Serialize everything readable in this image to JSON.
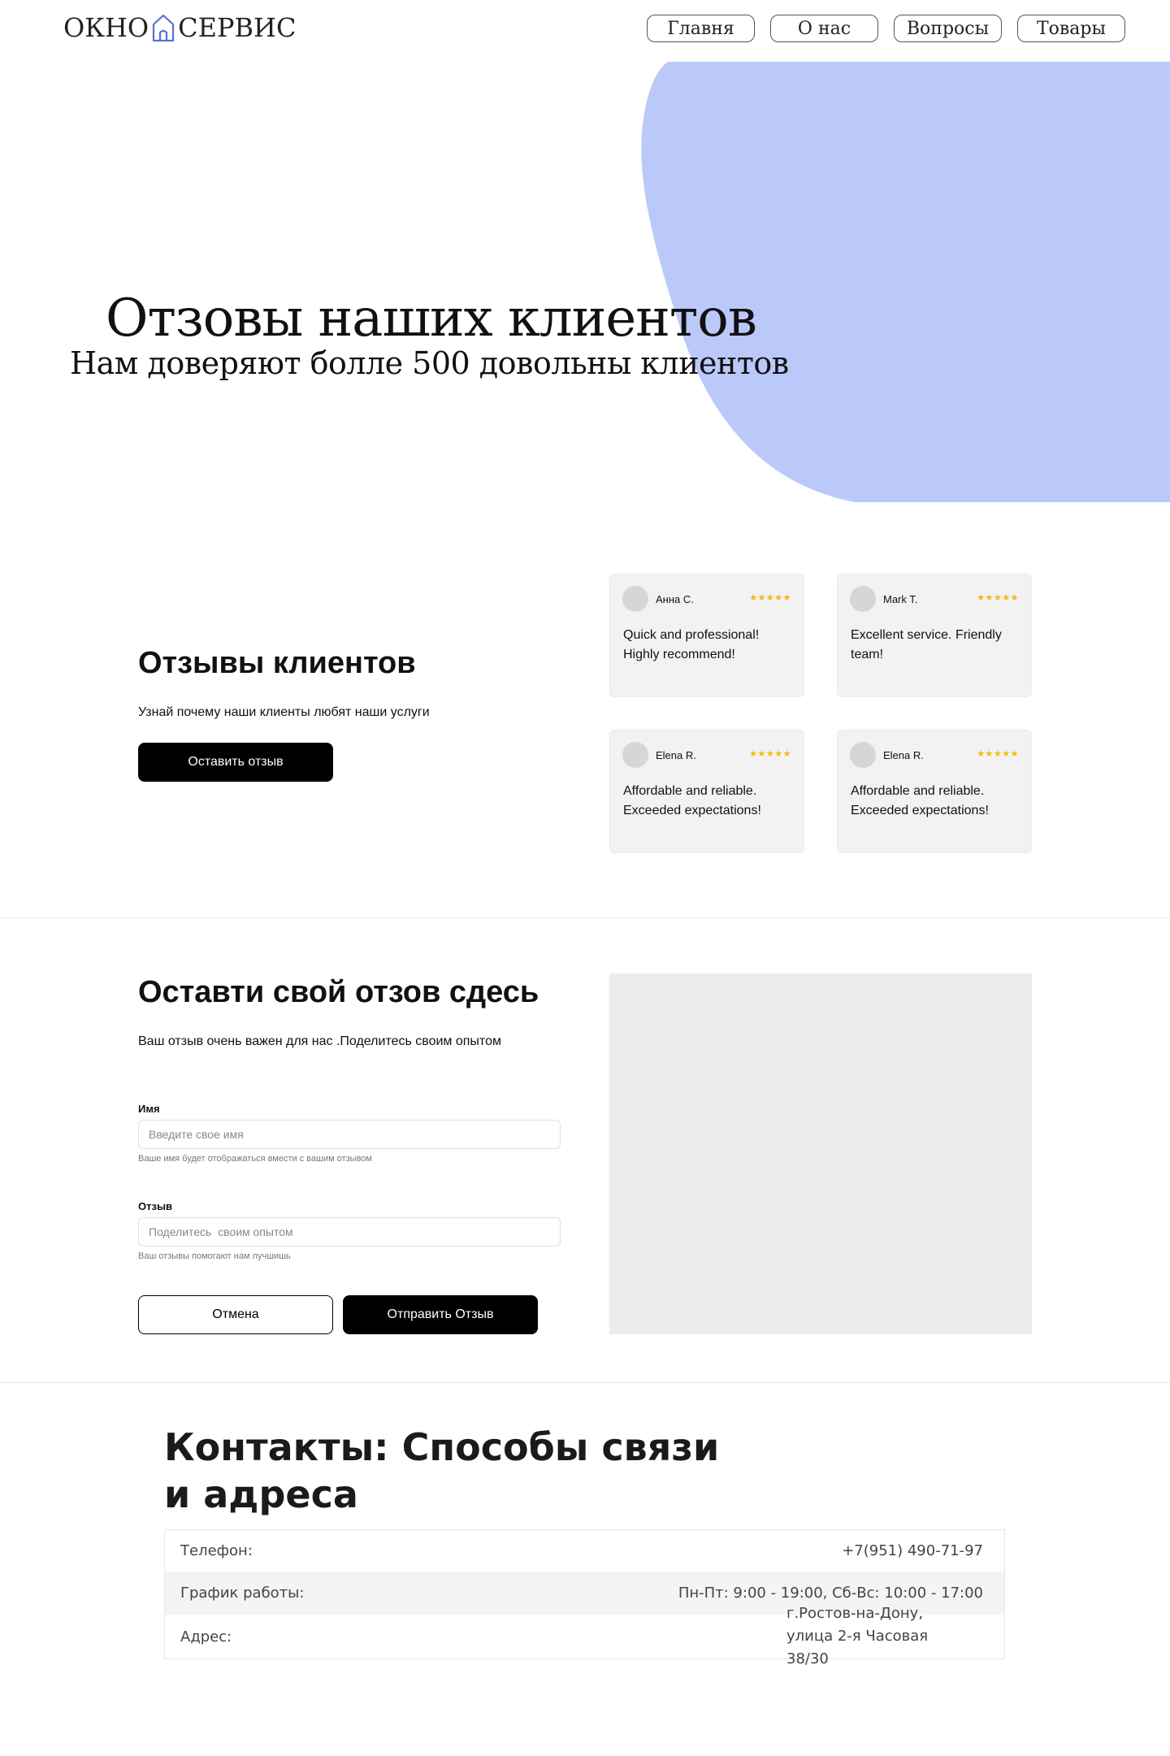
{
  "header": {
    "logo_left": "ОКНО",
    "logo_icon": "house-icon",
    "logo_right": "СЕРВИС",
    "nav": [
      "Главня",
      "О нас",
      "Вопросы",
      "Товары"
    ]
  },
  "hero": {
    "title": "Отзовы наших клиентов",
    "subtitle": "Нам доверяют болле 500 довольны клиентов",
    "blob_color": "#bbc9fa"
  },
  "reviews": {
    "title": "Отзывы клиентов",
    "description": "Узнай почему наши клиенты любят наши услуги",
    "button_label": "Оставить отзыв",
    "items": [
      {
        "name": "Анна С.",
        "stars": "★★★★★",
        "text": "Quick and professional! Highly recommend!"
      },
      {
        "name": "Mark T.",
        "stars": "★★★★★",
        "text": "Excellent service. Friendly team!"
      },
      {
        "name": "Elena R.",
        "stars": "★★★★★",
        "text": "Affordable and reliable. Exceeded expectations!"
      },
      {
        "name": "Elena R.",
        "stars": "★★★★★",
        "text": "Affordable and reliable. Exceeded expectations!"
      }
    ]
  },
  "form": {
    "title": "Оставти свой отзов сдесь",
    "description": "Ваш отзыв очень важен для нас .Поделитесь своим опытом",
    "name_label": "Имя",
    "name_placeholder": "Введите свое имя",
    "name_hint": "Ваше имя будет отображаться вмести с вашим отзывом",
    "review_label": "Отзыв",
    "review_placeholder": "Поделитесь  своим опытом",
    "review_hint": "Ваш отзывы помогают нам лучшишь",
    "cancel_label": "Отмена",
    "submit_label": "Отправить Отзыв"
  },
  "contacts": {
    "title": "Контакты: Способы связи и адреса",
    "rows": [
      {
        "label": "Телефон:",
        "value": "+7(951) 490-71-97"
      },
      {
        "label": "График работы:",
        "value": "Пн-Пт: 9:00 - 19:00, Сб-Вс: 10:00 - 17:00"
      },
      {
        "label": "Адрес:",
        "value": "г.Ростов-на-Дону, улица 2-я Часовая 38/30"
      }
    ]
  }
}
